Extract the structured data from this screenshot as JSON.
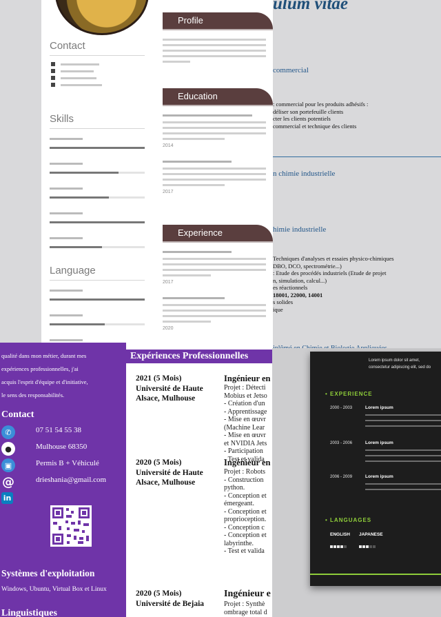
{
  "resume_grey": {
    "sections": {
      "contact": "Contact",
      "skills": "Skills",
      "language": "Language"
    },
    "banners": {
      "profile": "Profile",
      "education": "Education",
      "experience": "Experience"
    },
    "years": [
      "2014",
      "2017",
      "2017",
      "2020"
    ]
  },
  "resume_fr": {
    "title": "ulum vitae",
    "heading_commercial": "commercial",
    "commercial_lines": [
      ": commercial pour les produits adhésifs :",
      "déliser son portefeuille clients",
      "cter les clients potentiels",
      "commercial et technique des clients"
    ],
    "heading_chimie_1": "n chimie industrielle",
    "heading_chimie_2": "himie industrielle",
    "chimie_lines": [
      "Techniques d'analyses et essaies physico-chimiques",
      "DBO, DCO, spectrométrie...)",
      ": Etude des procédés industriels (Etude de projet",
      "n, simulation, calcul...)",
      "es réactionnels",
      "18001, 22000, 14001",
      "s solides",
      "ique"
    ],
    "bottom_cut": "iplômé en Chimie et Biologie Appliquées"
  },
  "sidebar": {
    "intro_lines": [
      "qualité dans mon métier, durant mes",
      "expériences   professionnelles,    j'ai",
      "acquis l'esprit d'équipe et d'initiative,",
      "le sens des responsabilités."
    ],
    "contact_heading": "Contact",
    "contacts": [
      {
        "icon": "phone-icon",
        "glyph": "✆",
        "text": "07 51 54 55 38"
      },
      {
        "icon": "location-pin-icon",
        "glyph": "●",
        "text": "Mulhouse 68350"
      },
      {
        "icon": "car-icon",
        "glyph": "▣",
        "text": "Permis B + Véhiculé"
      },
      {
        "icon": "email-icon",
        "glyph": "@",
        "text": "drieshania@gmail.com"
      },
      {
        "icon": "linkedin-icon",
        "glyph": "in",
        "text": ""
      }
    ],
    "os_heading": "Systèmes d'exploitation",
    "os_text": "Windows, Ubuntu, Virtual Box et Linux",
    "ling_heading": "Linguistiques"
  },
  "experiences": {
    "header": "Expériences Professionnelles",
    "entries": [
      {
        "date": "2021 (5 Mois)",
        "org_lines": [
          "Université de Haute",
          "Alsace, Mulhouse"
        ],
        "title": "Ingénieur en",
        "lines": [
          "Projet : Détecti",
          "Mobius et Jetso",
          "- Création d'un",
          "- Apprentissage",
          "- Mise en œuvr",
          "(Machine Lear",
          "- Mise en œuvr",
          "et NVIDIA Jets",
          "- Participation",
          "- Test et valida"
        ]
      },
      {
        "date": "2020 (5 Mois)",
        "org_lines": [
          "Université de Haute",
          "Alsace, Mulhouse"
        ],
        "title": "Ingénieur en",
        "lines": [
          "Projet : Robots",
          "- Construction",
          "python.",
          "- Conception et",
          "émergeant.",
          "- Conception et",
          "proprioception.",
          "-  Conception c",
          "- Conception et",
          "labyrinthe.",
          "- Test et valida"
        ]
      },
      {
        "date": "2020 (5 Mois)",
        "org_lines": [
          "Université de Bejaia"
        ],
        "title": "Ingénieur e",
        "lines": [
          "Projet : Synthè",
          "ombrage total d"
        ]
      }
    ]
  },
  "dark_resume": {
    "top_lines": [
      "Lorem ipsum dolor sit amet,",
      "consectetur adipiscing elit, sed do"
    ],
    "experience_heading": "• EXPERIENCE",
    "jobs": [
      {
        "years": "2000 - 2003",
        "title": "Lorem ipsum"
      },
      {
        "years": "2003 - 2006",
        "title": "Lorem ipsum"
      },
      {
        "years": "2006 - 2009",
        "title": "Lorem ipsum"
      }
    ],
    "languages_heading": "• LANGUAGES",
    "languages": [
      {
        "name": "ENGLISH",
        "level": 0.8
      },
      {
        "name": "JAPANESE",
        "level": 0.6
      }
    ],
    "accent_color": "#8fce3a"
  }
}
